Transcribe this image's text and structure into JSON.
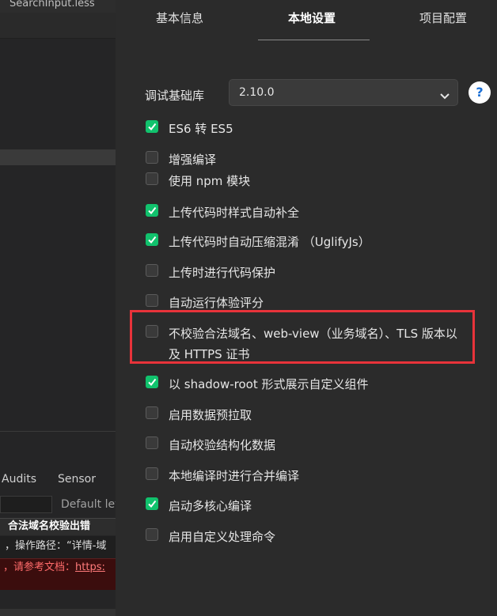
{
  "left_panel": {
    "file_tab": "SearchInput.less",
    "devtools_tabs": [
      "Audits",
      "Sensor"
    ],
    "filter_level": "Default lev",
    "error_title": "合法域名校验出错",
    "error_line1": "，操作路径：“详情-域",
    "error_line2_prefix": "，请参考文档：",
    "error_line2_link": "https:"
  },
  "tabs": [
    {
      "label": "基本信息",
      "active": false
    },
    {
      "label": "本地设置",
      "active": true
    },
    {
      "label": "项目配置",
      "active": false
    }
  ],
  "base_library": {
    "label": "调试基础库",
    "value": "2.10.0",
    "help": "?"
  },
  "options": [
    {
      "label": "ES6 转 ES5",
      "checked": true
    },
    {
      "label": "增强编译",
      "checked": false
    },
    {
      "label": "使用 npm 模块",
      "checked": false
    },
    {
      "label": "上传代码时样式自动补全",
      "checked": true
    },
    {
      "label": "上传代码时自动压缩混淆 （UglifyJs）",
      "checked": true
    },
    {
      "label": "上传时进行代码保护",
      "checked": false
    },
    {
      "label": "自动运行体验评分",
      "checked": false
    },
    {
      "label": "不校验合法域名、web-view（业务域名）、TLS 版本以及 HTTPS 证书",
      "checked": false
    },
    {
      "label": "以 shadow-root 形式展示自定义组件",
      "checked": true
    },
    {
      "label": "启用数据预拉取",
      "checked": false
    },
    {
      "label": "自动校验结构化数据",
      "checked": false
    },
    {
      "label": "本地编译时进行合并编译",
      "checked": false
    },
    {
      "label": "启动多核心编译",
      "checked": true
    },
    {
      "label": "启用自定义处理命令",
      "checked": false
    }
  ],
  "colors": {
    "checked": "#11c26d",
    "highlight_border": "#e8333a",
    "help_icon": "#1a6fd6"
  }
}
